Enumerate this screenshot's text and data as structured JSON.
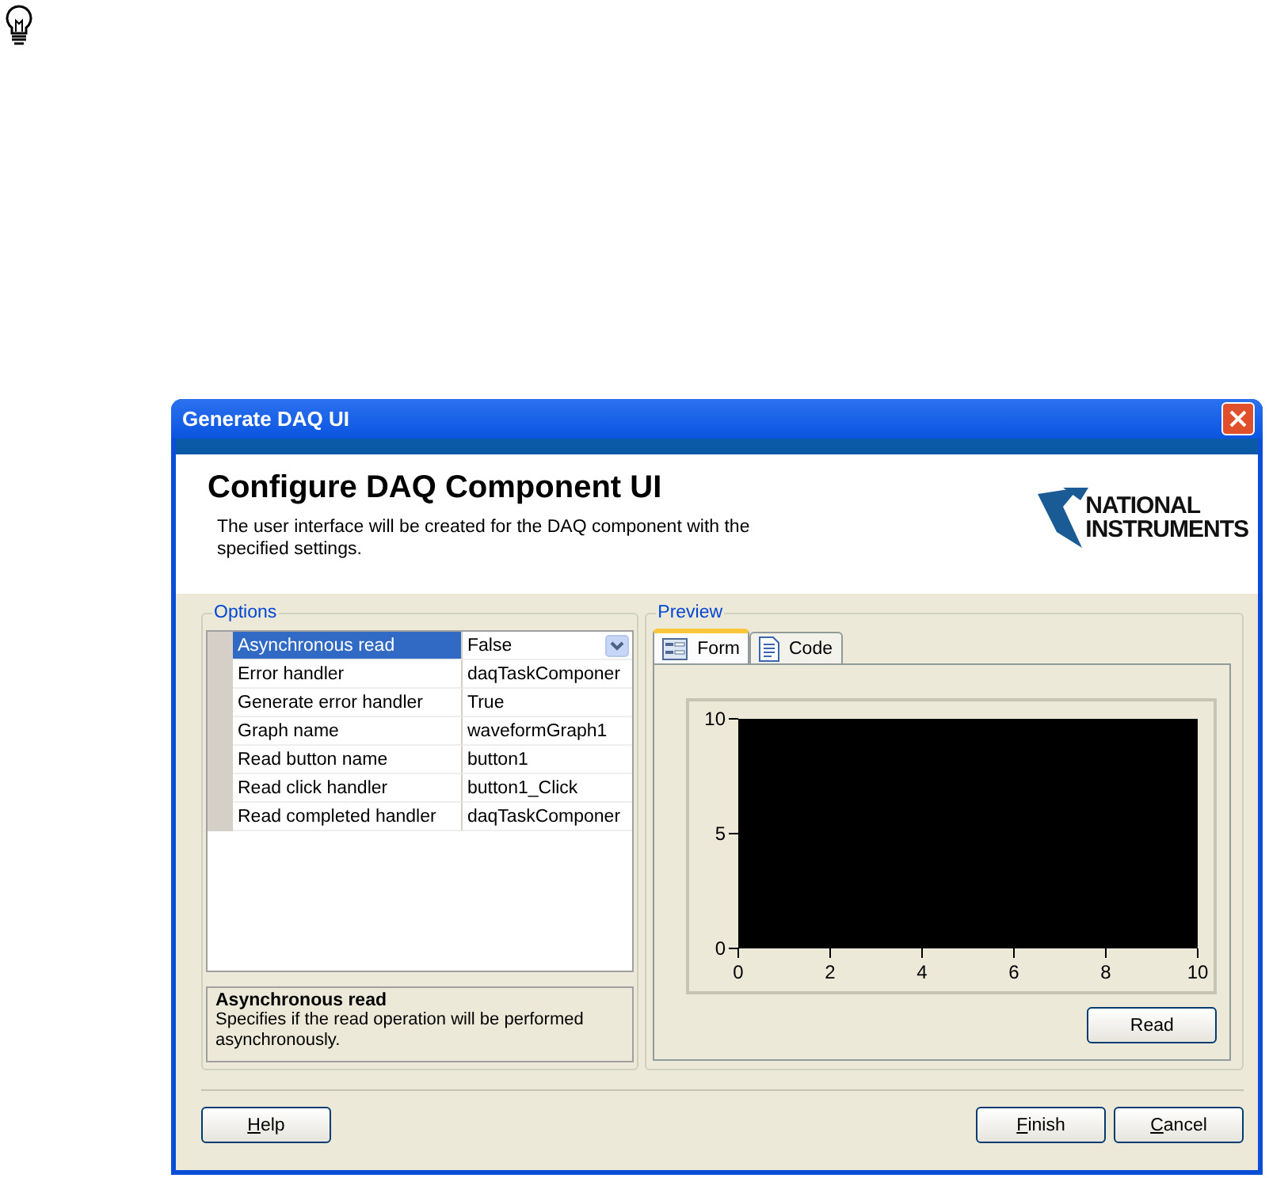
{
  "window": {
    "title": "Generate DAQ UI"
  },
  "header": {
    "title": "Configure DAQ Component UI",
    "logo_lines": [
      "NATIONAL",
      "INSTRUMENTS"
    ],
    "description": "The user interface will be created for the DAQ component with the specified settings."
  },
  "options": {
    "title": "Options",
    "properties": [
      {
        "name": "Asynchronous read",
        "value": "False",
        "selected": true,
        "kind": "dropdown"
      },
      {
        "name": "Error handler",
        "value": "daqTaskComponer",
        "selected": false,
        "kind": "text"
      },
      {
        "name": "Generate error handler",
        "value": "True",
        "selected": false,
        "kind": "text"
      },
      {
        "name": "Graph name",
        "value": "waveformGraph1",
        "selected": false,
        "kind": "text"
      },
      {
        "name": "Read button name",
        "value": "button1",
        "selected": false,
        "kind": "text"
      },
      {
        "name": "Read click handler",
        "value": "button1_Click",
        "selected": false,
        "kind": "text"
      },
      {
        "name": "Read completed handler",
        "value": "daqTaskComponer",
        "selected": false,
        "kind": "text"
      }
    ],
    "help_title": "Asynchronous read",
    "help_text": "Specifies if the read operation will be performed asynchronously."
  },
  "preview": {
    "title": "Preview",
    "tabs": [
      {
        "label": "Form",
        "selected": true,
        "kind": "form"
      },
      {
        "label": "Code",
        "selected": false,
        "kind": "code"
      }
    ],
    "chart_data": {
      "type": "line",
      "xlim": [
        0,
        10
      ],
      "ylim": [
        0,
        10
      ],
      "xticks": [
        0,
        2,
        4,
        6,
        8,
        10
      ],
      "yticks": [
        0,
        5,
        10
      ]
    },
    "read_button": "Read"
  },
  "buttons": {
    "help": "Help",
    "finish": "Finish",
    "cancel": "Cancel"
  }
}
